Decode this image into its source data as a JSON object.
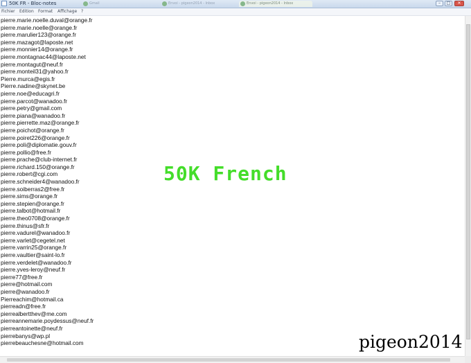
{
  "window": {
    "title": "50K FR - Bloc-notes",
    "background_tabs": [
      "Gmail",
      "Envoi - pigeon2014 - Inbox",
      "Envoi - pigeon2014 - Inbox"
    ],
    "controls": {
      "minimize": "–",
      "maximize": "□",
      "close": "✕"
    }
  },
  "menu": {
    "items": [
      "Fichier",
      "Edition",
      "Format",
      "Affichage",
      "?"
    ]
  },
  "document": {
    "lines": [
      "pierre.marie.noelle.duval@orange.fr",
      "pierre.marie.noelle@orange.fr",
      "pierre.marulier123@orange.fr",
      "pierre.mazagot@laposte.net",
      "pierre.monnier14@orange.fr",
      "pierre.montagnac44@laposte.net",
      "pierre.montagut@neuf.fr",
      "pierre.monteil31@yahoo.fr",
      "Pierre.murca@egis.fr",
      "Pierre.nadine@skynet.be",
      "pierre.noe@educagri.fr",
      "pierre.parcot@wanadoo.fr",
      "pierre.petry@gmail.com",
      "pierre.piana@wanadoo.fr",
      "pierre.pierrette.maz@orange.fr",
      "pierre.poichot@orange.fr",
      "pierre.poiret226@orange.fr",
      "pierre.poli@diplomatie.gouv.fr",
      "pierre.pollio@free.fr",
      "pierre.prache@club-internet.fr",
      "pierre.richard.150@orange.fr",
      "pierre.robert@cgi.com",
      "pierre.schneider4@wanadoo.fr",
      "pierre.soiberras2@free.fr",
      "pierre.sims@orange.fr",
      "pierre.stepien@orange.fr",
      "pierre.talbot@hotmail.fr",
      "pierre.theo0708@orange.fr",
      "pierre.thinus@sfr.fr",
      "pierre.vadurel@wanadoo.fr",
      "pierre.varlet@cegetel.net",
      "pierre.varrin25@orange.fr",
      "pierre.vaultier@saint-lo.fr",
      "pierre.verdelet@wanadoo.fr",
      "pierre.yves-leroy@neuf.fr",
      "pierre77@free.fr",
      "pierre@hotmail.com",
      "pierre@wanadoo.fr",
      "Pierreachim@hotmail.ca",
      "pierreadn@free.fr",
      "pierrealbertthev@me.com",
      "pierreannemarie.poydessus@neuf.fr",
      "pierreantoinette@neuf.fr",
      "pierrebanys@wp.pl",
      "pierrebeauchesne@hotmail.com"
    ]
  },
  "overlay": {
    "headline": "50K French",
    "signature": "pigeon2014",
    "headline_color": "#44dd2a"
  }
}
